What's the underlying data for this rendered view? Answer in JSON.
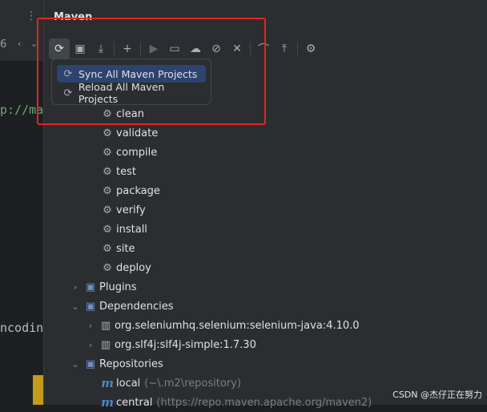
{
  "editor": {
    "tab_dots": "⋮",
    "tab_num": "6",
    "code_line1": "p://ma",
    "code_line2": "ncodin"
  },
  "panel": {
    "title": "Maven"
  },
  "toolbar": {
    "buttons": [
      {
        "name": "sync-icon",
        "glyph": "⟳"
      },
      {
        "name": "add-folder-icon",
        "glyph": "🗀"
      },
      {
        "name": "download-icon",
        "glyph": "⤓"
      },
      {
        "name": "add-icon",
        "glyph": "+"
      },
      {
        "name": "run-icon",
        "glyph": "▶"
      },
      {
        "name": "execute-goal-icon",
        "glyph": "▭"
      },
      {
        "name": "offline-icon",
        "glyph": "☁"
      },
      {
        "name": "skip-tests-icon",
        "glyph": "⊘"
      },
      {
        "name": "collapse-icon",
        "glyph": "⨯"
      },
      {
        "name": "show-deps-icon",
        "glyph": "⌒"
      },
      {
        "name": "expand-all-icon",
        "glyph": "⤒"
      },
      {
        "name": "settings-icon",
        "glyph": "⚙"
      }
    ]
  },
  "popup": {
    "items": [
      {
        "label": "Sync All Maven Projects",
        "selected": true
      },
      {
        "label": "Reload All Maven Projects",
        "selected": false
      }
    ]
  },
  "tree": {
    "lifecycle": [
      "clean",
      "validate",
      "compile",
      "test",
      "package",
      "verify",
      "install",
      "site",
      "deploy"
    ],
    "plugins_label": "Plugins",
    "dependencies_label": "Dependencies",
    "dependencies": [
      "org.seleniumhq.selenium:selenium-java:4.10.0",
      "org.slf4j:slf4j-simple:1.7.30"
    ],
    "repositories_label": "Repositories",
    "repositories": [
      {
        "name": "local",
        "url": "(~\\.m2\\repository)"
      },
      {
        "name": "central",
        "url": "(https://repo.maven.apache.org/maven2)"
      }
    ]
  },
  "watermark": "CSDN @杰仔正在努力"
}
